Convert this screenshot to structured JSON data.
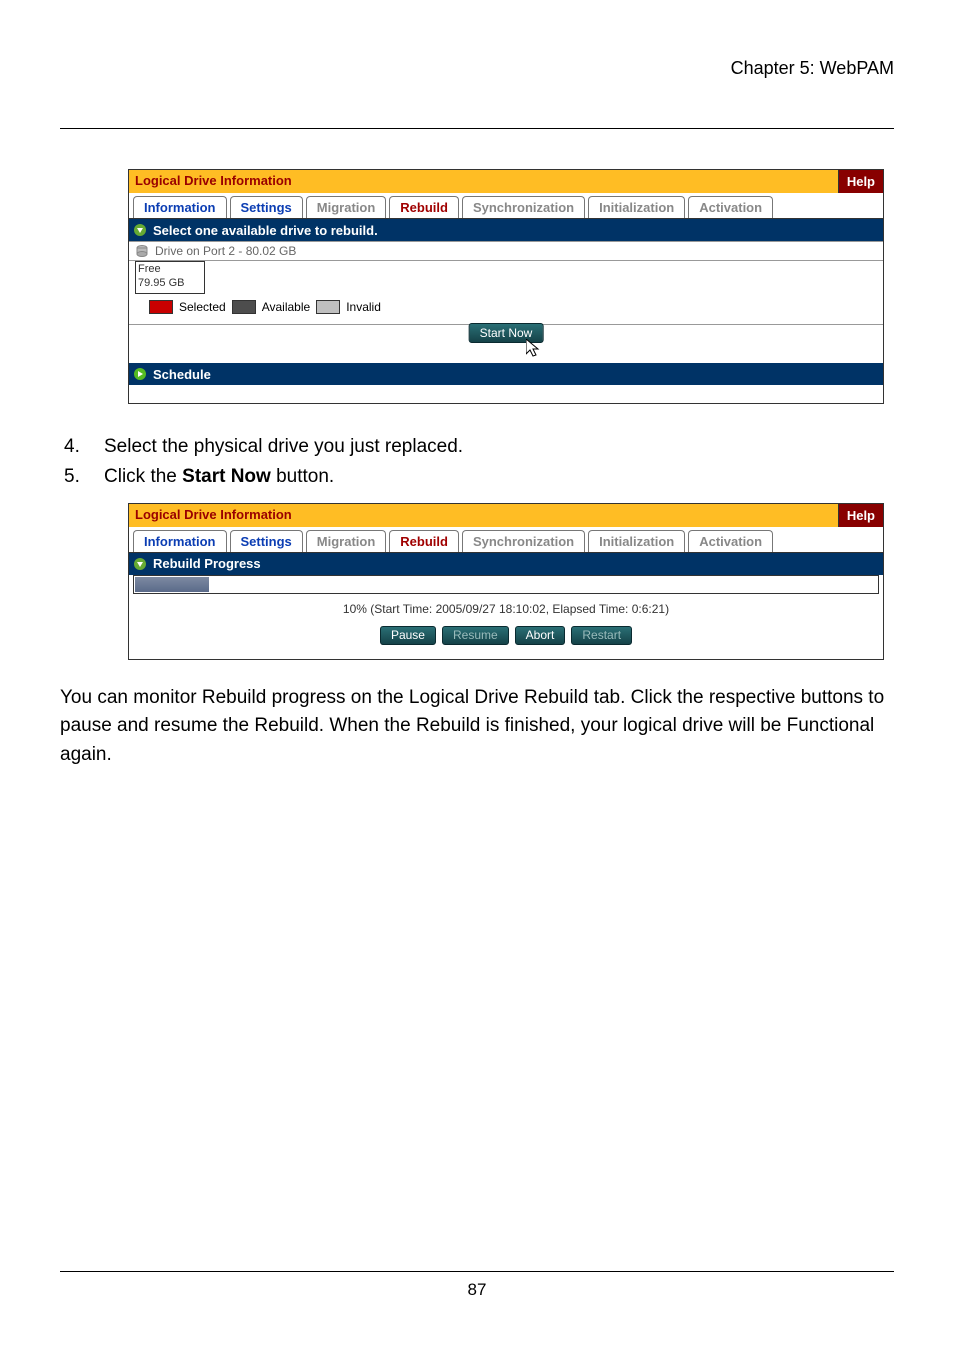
{
  "header": {
    "chapter_title": "Chapter 5: WebPAM"
  },
  "panel1": {
    "title": "Logical Drive Information",
    "help_label": "Help",
    "tabs": {
      "information": "Information",
      "settings": "Settings",
      "migration": "Migration",
      "rebuild": "Rebuild",
      "synchronization": "Synchronization",
      "initialization": "Initialization",
      "activation": "Activation"
    },
    "section_bar": "Select one available drive to rebuild.",
    "drive_label": "Drive on Port 2 - 80.02 GB",
    "drive_status_line1": "Free",
    "drive_status_line2": "79.95 GB",
    "legend": {
      "selected": "Selected",
      "available": "Available",
      "invalid": "Invalid"
    },
    "start_now_label": "Start Now",
    "schedule_label": "Schedule"
  },
  "steps": [
    {
      "num": "4.",
      "text_before": "Select the physical drive you just replaced.",
      "bold": "",
      "text_after": ""
    },
    {
      "num": "5.",
      "text_before": "Click the ",
      "bold": "Start Now",
      "text_after": " button."
    }
  ],
  "panel2": {
    "title": "Logical Drive Information",
    "help_label": "Help",
    "tabs": {
      "information": "Information",
      "settings": "Settings",
      "migration": "Migration",
      "rebuild": "Rebuild",
      "synchronization": "Synchronization",
      "initialization": "Initialization",
      "activation": "Activation"
    },
    "section_bar": "Rebuild Progress",
    "progress_percent": 10,
    "progress_text": "10% (Start Time: 2005/09/27 18:10:02, Elapsed Time: 0:6:21)",
    "buttons": {
      "pause": "Pause",
      "resume": "Resume",
      "abort": "Abort",
      "restart": "Restart"
    }
  },
  "paragraph": "You can monitor Rebuild progress on the Logical Drive Rebuild tab. Click the respective buttons to pause and resume the Rebuild. When the Rebuild is finished, your logical drive will be Functional again.",
  "footer": {
    "page_number": "87"
  }
}
